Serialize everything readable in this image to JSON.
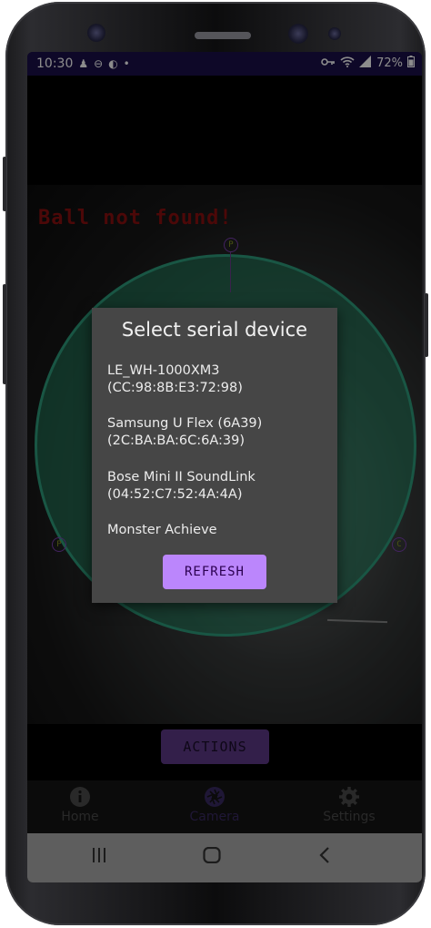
{
  "status_bar": {
    "time": "10:30",
    "battery": "72%",
    "left_icons": [
      "person-icon",
      "dnd-icon",
      "cloud-icon",
      "dot-icon"
    ],
    "right_icons": [
      "key-icon",
      "wifi-icon",
      "signal-icon",
      "battery-icon"
    ]
  },
  "camera": {
    "ball_status": "Ball not found!",
    "markers": [
      "P",
      "P",
      "C"
    ]
  },
  "dialog": {
    "title": "Select serial device",
    "devices": [
      {
        "name": "LE_WH-1000XM3",
        "address": "(CC:98:8B:E3:72:98)"
      },
      {
        "name": "Samsung U Flex (6A39)",
        "address": "(2C:BA:BA:6C:6A:39)"
      },
      {
        "name": "Bose Mini II SoundLink",
        "address": "(04:52:C7:52:4A:4A)"
      },
      {
        "name": "Monster Achieve",
        "address": ""
      }
    ],
    "refresh_label": "REFRESH"
  },
  "actions_label": "ACTIONS",
  "bottom_nav": {
    "items": [
      {
        "label": "Home",
        "icon": "info-icon"
      },
      {
        "label": "Camera",
        "icon": "aperture-icon"
      },
      {
        "label": "Settings",
        "icon": "gear-icon"
      }
    ],
    "active_index": 1
  },
  "colors": {
    "status_bar": "#1a0f4a",
    "accent": "#bb86fc",
    "actions_button": "#5e3a88",
    "tracking_circle": "#2e9d7d",
    "ball_status": "#8b0f0f"
  }
}
